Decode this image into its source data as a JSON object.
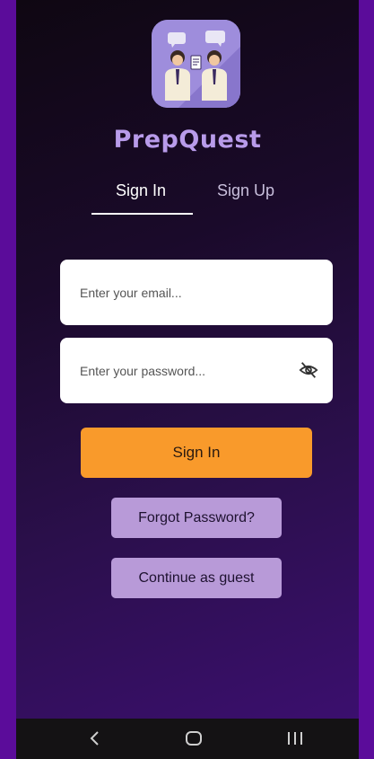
{
  "app": {
    "name": "PrepQuest"
  },
  "tabs": [
    {
      "label": "Sign In",
      "active": true
    },
    {
      "label": "Sign Up",
      "active": false
    }
  ],
  "form": {
    "email_placeholder": "Enter your email...",
    "password_placeholder": "Enter your password...",
    "password_visibility_icon": "eye-off-icon",
    "signin_label": "Sign In",
    "forgot_label": "Forgot Password?",
    "guest_label": "Continue as guest"
  },
  "navbar": {
    "icons": [
      "back-icon",
      "home-icon",
      "recent-apps-icon"
    ]
  },
  "colors": {
    "accent": "#f99a2b",
    "brand_text": "#b89bea",
    "secondary_button": "#b89ad8",
    "frame": "#5b0c9a"
  }
}
